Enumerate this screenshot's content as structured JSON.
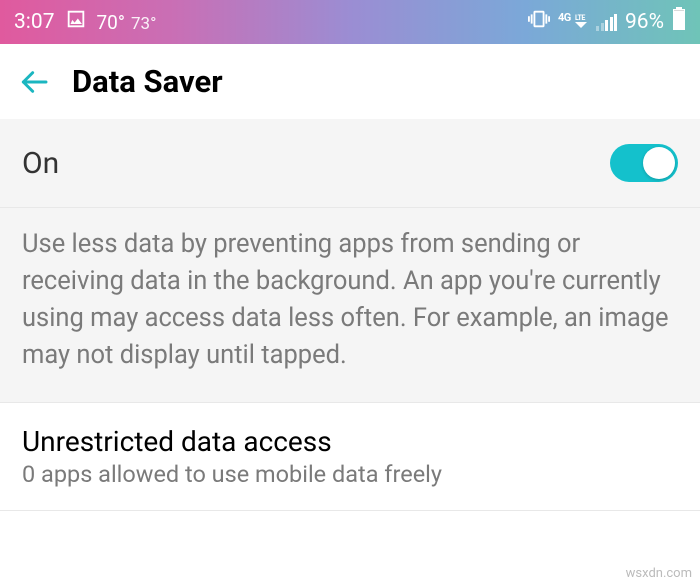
{
  "status_bar": {
    "time": "3:07",
    "temp_primary": "70°",
    "temp_secondary": "73°",
    "network_label": "4G LTE",
    "battery_pct": "96%"
  },
  "header": {
    "title": "Data Saver"
  },
  "toggle": {
    "label": "On",
    "enabled": true
  },
  "description": {
    "text": "Use less data by preventing apps from sending or receiving data in the background. An app you're currently using may access data less often. For example, an image may not display until tapped."
  },
  "unrestricted": {
    "title": "Unrestricted data access",
    "subtitle": "0 apps allowed to use mobile data freely"
  },
  "watermark": "wsxdn.com"
}
